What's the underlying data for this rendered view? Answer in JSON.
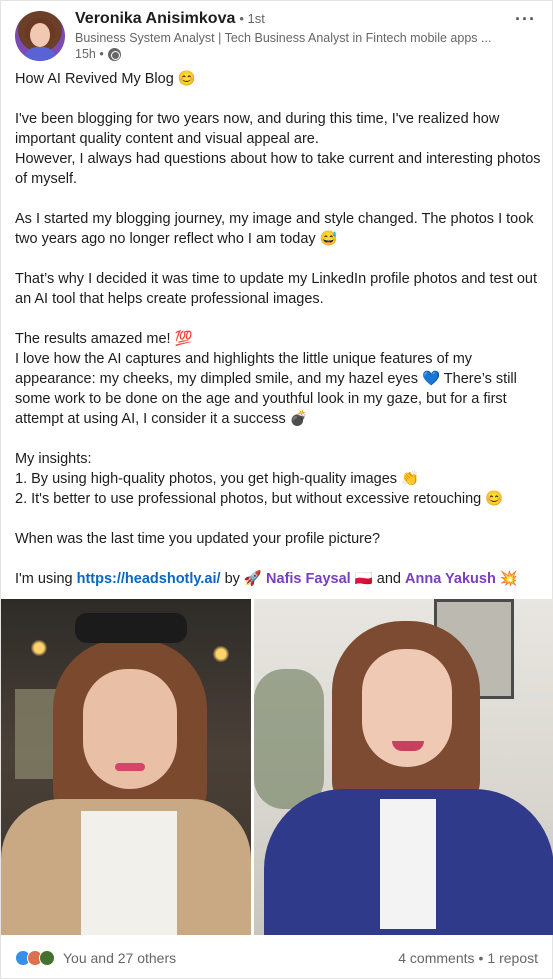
{
  "author": {
    "name": "Veronika Anisimkova",
    "degree": "• 1st",
    "headline": "Business System Analyst | Tech Business Analyst in Fintech mobile apps ...",
    "time": "15h •"
  },
  "post": {
    "title": "How AI Revived My Blog 😊",
    "p1": "I've been blogging for two years now, and during this time, I've realized how important quality content and visual appeal are.",
    "p2": "However, I always had questions about how to take current and interesting photos of myself.",
    "p3": "As I started my blogging journey, my image and style changed. The photos I took two years ago no longer reflect who I am today 😅",
    "p4": "That’s why I decided it was time to update my LinkedIn profile photos and test out an AI tool that helps create professional images.",
    "p5": "The results amazed me! 💯",
    "p6": "I love how the AI captures and highlights the little unique features of my appearance: my cheeks, my dimpled smile, and my hazel eyes 💙 There’s still some work to be done on the age and youthful look in my gaze, but for a first attempt at using AI, I consider it a success 💣",
    "insights_label": "My insights:",
    "insight1": "1. By using high-quality photos, you get high-quality images 👏",
    "insight2": "2. It's better to use professional photos, but without excessive retouching 😊",
    "question": "When was the last time you updated your profile picture?",
    "using_prefix": "I'm using ",
    "link": "https://headshotly.ai/",
    "by": " by 🚀 ",
    "mention1": "Nafis Faysal",
    "flag": " 🇵🇱 and ",
    "mention2": "Anna Yakush",
    "end_emoji": " 💥"
  },
  "footer": {
    "reactions_text": "You and 27 others",
    "comments": "4 comments",
    "separator": "•",
    "reposts": "1 repost"
  },
  "menu_glyph": "···"
}
